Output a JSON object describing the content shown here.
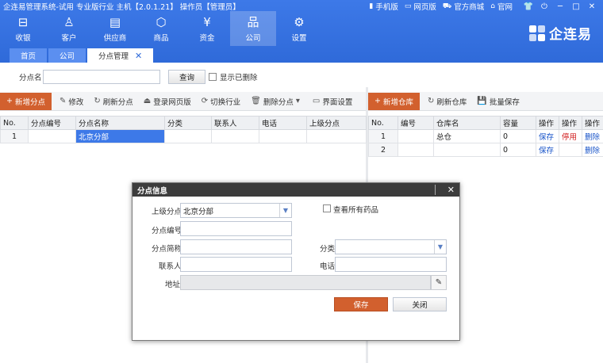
{
  "app": {
    "title": "企连易管理系统-试用 专业版行业 主机【2.0.1.21】 操作员【管理员】",
    "links": [
      {
        "icon": "phone-icon",
        "glyph": "▮",
        "label": "手机版"
      },
      {
        "icon": "monitor-icon",
        "glyph": "▭",
        "label": "网页版"
      },
      {
        "icon": "cart-icon",
        "glyph": "⛟",
        "label": "官方商城"
      },
      {
        "icon": "home-icon",
        "glyph": "⌂",
        "label": "官网"
      }
    ],
    "brand": "企连易"
  },
  "nav": [
    {
      "label": "收银",
      "icon": "cashier-icon",
      "glyph": "⊟"
    },
    {
      "label": "客户",
      "icon": "customer-icon",
      "glyph": "♙"
    },
    {
      "label": "供应商",
      "icon": "supplier-icon",
      "glyph": "▤"
    },
    {
      "label": "商品",
      "icon": "goods-icon",
      "glyph": "⬡"
    },
    {
      "label": "资金",
      "icon": "funds-icon",
      "glyph": "¥"
    },
    {
      "label": "公司",
      "icon": "company-icon",
      "glyph": "品",
      "active": true
    },
    {
      "label": "设置",
      "icon": "settings-icon",
      "glyph": "⚙"
    }
  ],
  "tabs": [
    {
      "label": "首页"
    },
    {
      "label": "公司"
    },
    {
      "label": "分点管理",
      "active": true
    }
  ],
  "search": {
    "label": "分点名",
    "value": "",
    "query_button": "查询",
    "show_deleted": "显示已删除"
  },
  "left_toolbar": {
    "add": "新增分点",
    "edit": "修改",
    "refresh": "刷新分点",
    "web_login": "登录网页版",
    "switch_industry": "切换行业",
    "delete": "删除分点",
    "ui_settings": "界面设置"
  },
  "branch_grid": {
    "columns": [
      "No.",
      "分点编号",
      "分点名称",
      "分类",
      "联系人",
      "电话",
      "上级分点"
    ],
    "rows": [
      [
        "1",
        "",
        "北京分部",
        "",
        "",
        "",
        ""
      ]
    ]
  },
  "right_toolbar": {
    "add_warehouse": "新增仓库",
    "refresh_warehouse": "刷新仓库",
    "batch_save": "批量保存"
  },
  "warehouse_grid": {
    "columns": [
      "No.",
      "编号",
      "仓库名",
      "容量",
      "操作",
      "操作",
      "操作"
    ],
    "rows": [
      [
        "1",
        "",
        "总仓",
        "0",
        "保存",
        "停用",
        "删除"
      ],
      [
        "2",
        "",
        "",
        "0",
        "保存",
        "",
        "删除"
      ]
    ]
  },
  "dialog": {
    "title": "分点信息",
    "parent_label": "上级分点",
    "parent_value": "北京分部",
    "view_all_label": "查看所有药品",
    "code_label": "分点编号",
    "code_value": "",
    "short_name_label": "分点简称",
    "short_name_value": "",
    "category_label": "分类",
    "category_value": "",
    "contact_label": "联系人",
    "contact_value": "",
    "phone_label": "电话",
    "phone_value": "",
    "address_label": "地址",
    "address_value": "",
    "save_button": "保存",
    "close_button": "关闭"
  },
  "colors": {
    "header_blue": "#2f6ad9",
    "accent_orange": "#d2602e",
    "selection_blue": "#3d79e8",
    "link_blue": "#1a55c9",
    "disable_red": "#d01a1a"
  }
}
